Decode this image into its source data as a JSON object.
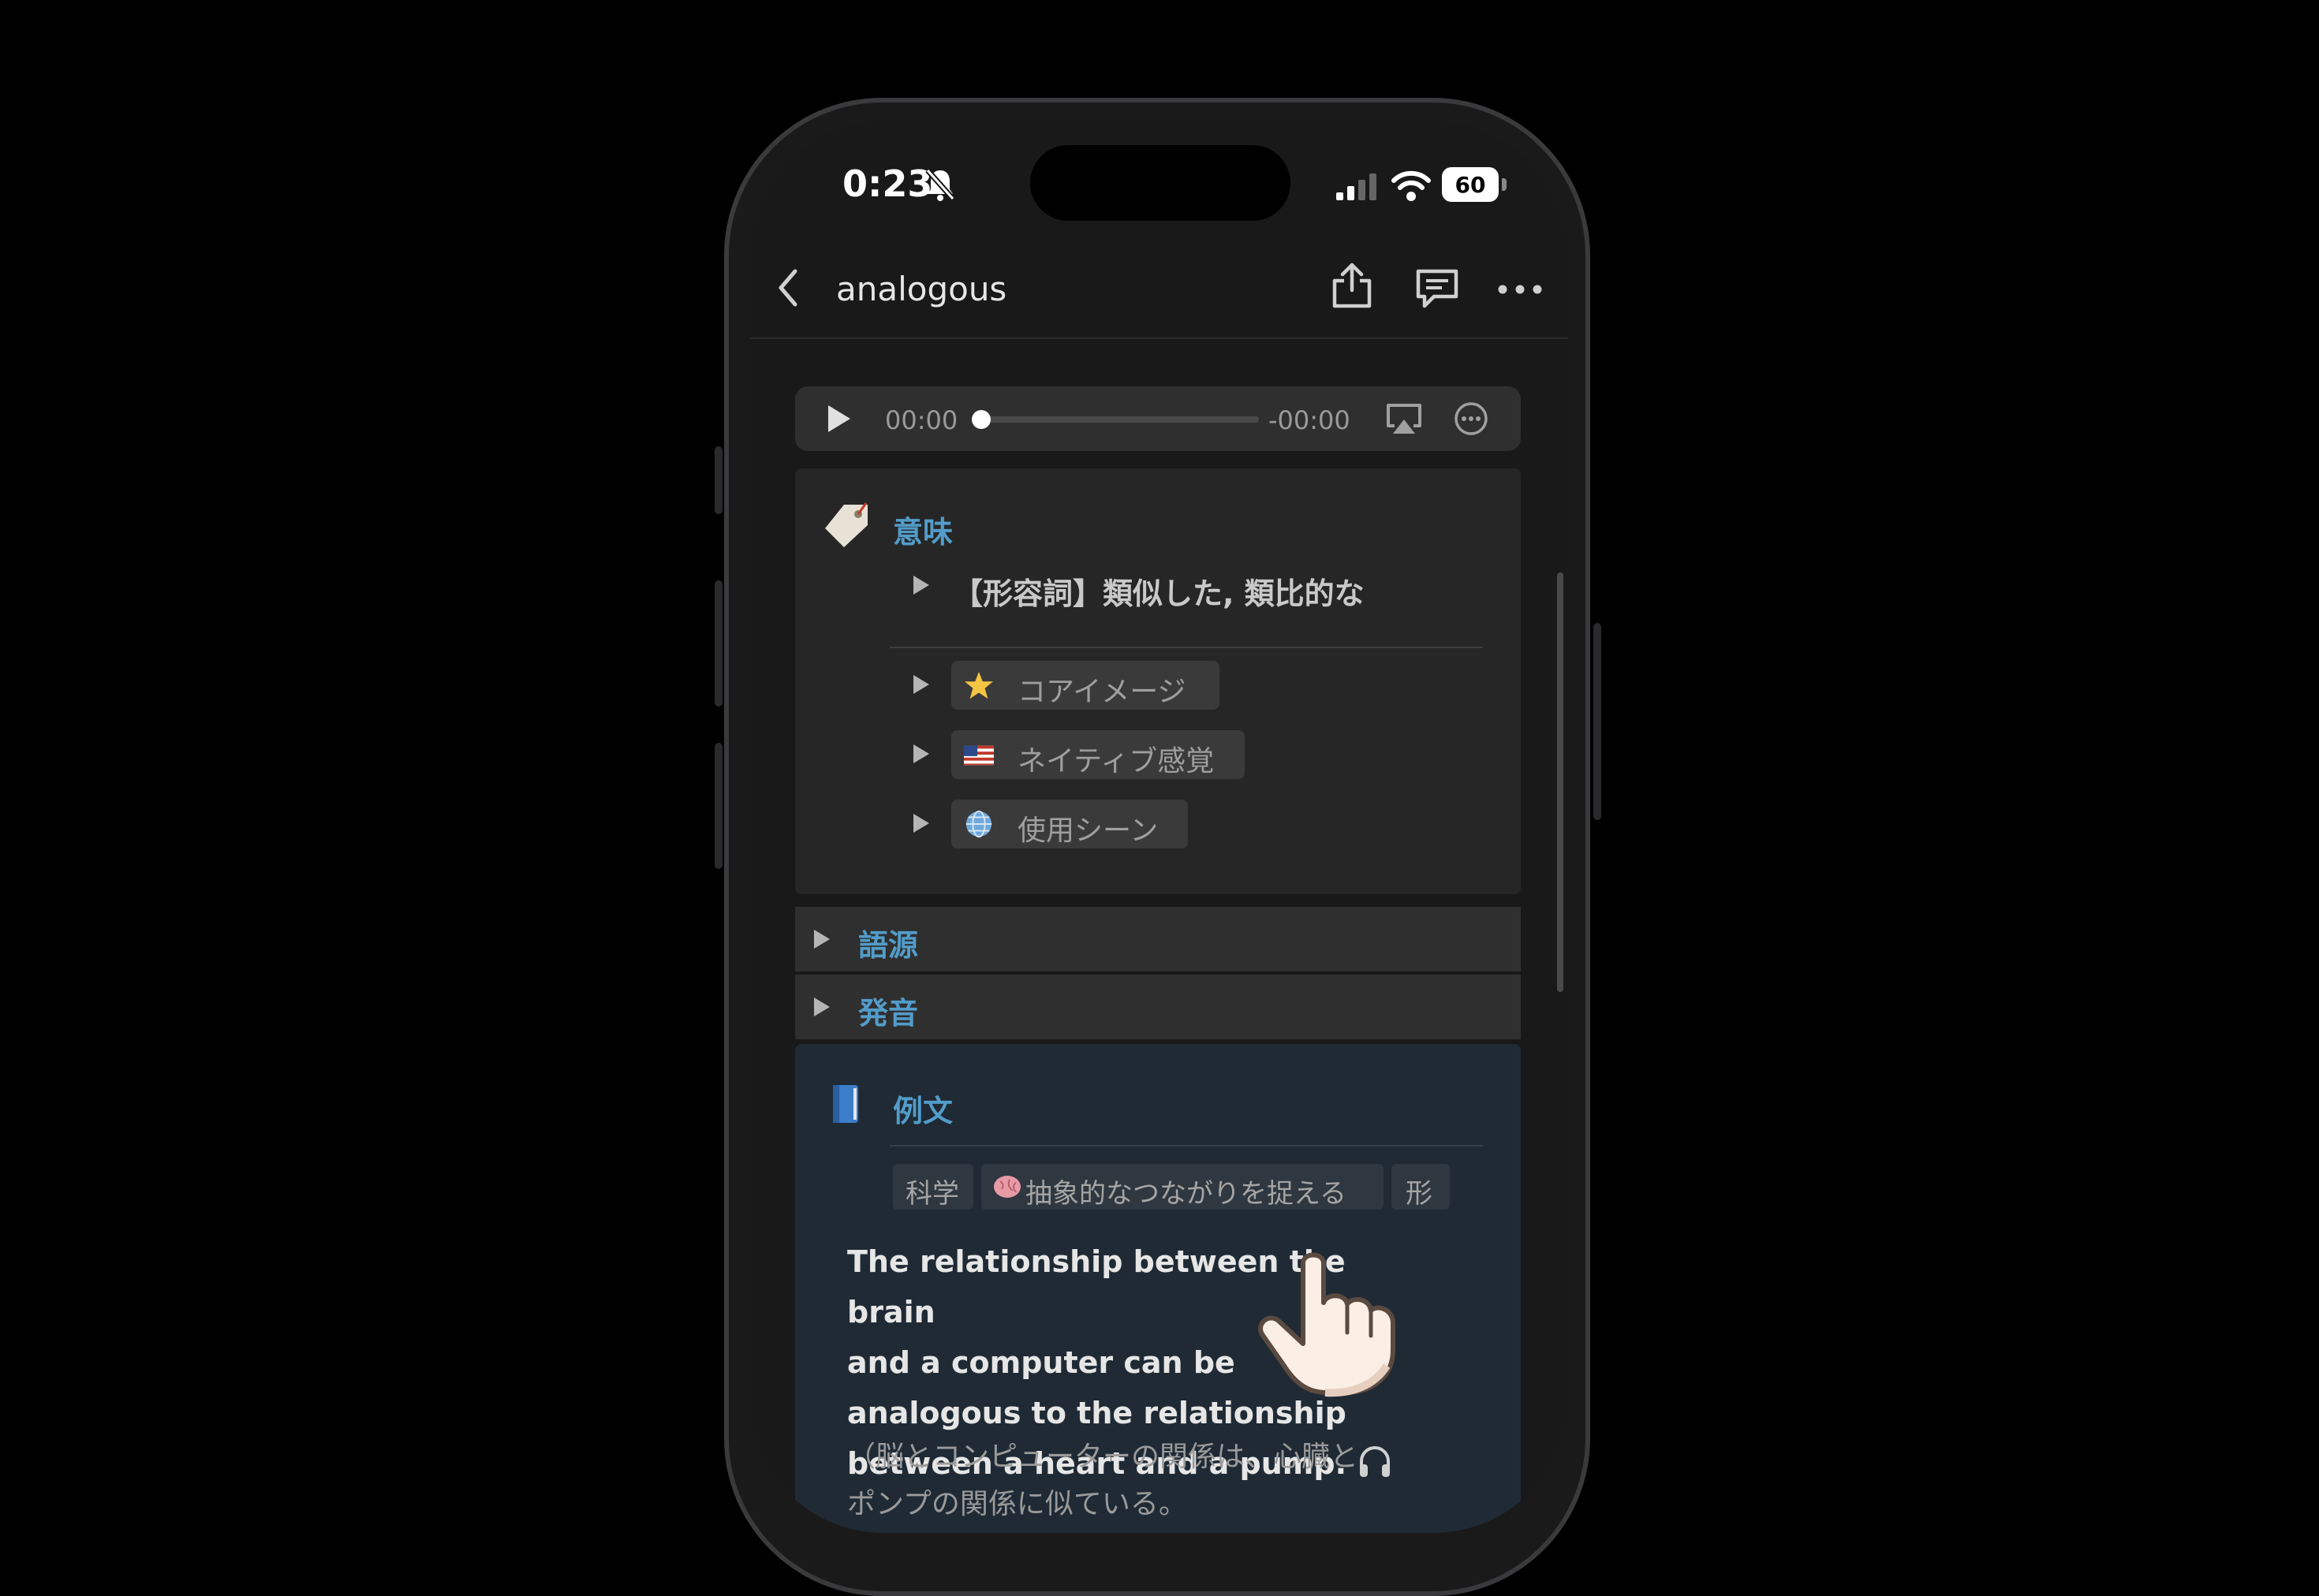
{
  "status_bar": {
    "time": "0:23",
    "battery": "60"
  },
  "nav": {
    "title": "analogous"
  },
  "player": {
    "elapsed": "00:00",
    "remaining": "-00:00",
    "progress": 0
  },
  "meaning": {
    "heading": "意味",
    "definition": "【形容詞】類似した, 類比的な",
    "chips": [
      {
        "label": "コアイメージ",
        "icon": "star-icon"
      },
      {
        "label": "ネイティブ感覚",
        "icon": "us-flag-icon"
      },
      {
        "label": "使用シーン",
        "icon": "globe-icon"
      }
    ]
  },
  "toggles": [
    {
      "label": "語源"
    },
    {
      "label": "発音"
    }
  ],
  "example": {
    "heading": "例文",
    "tags": [
      "科学",
      "抽象的なつながりを捉える",
      "形"
    ],
    "sentence": [
      "The relationship between the brain",
      "and a computer can be",
      "analogous to the relationship",
      "between a heart and a pump."
    ],
    "translation": [
      "（脳とコンピューターの関係は、心臓と",
      "ポンプの関係に似ている。"
    ]
  },
  "colors": {
    "accent": "#529cca",
    "background": "#191919",
    "callout_blue": "#1f2a35"
  }
}
